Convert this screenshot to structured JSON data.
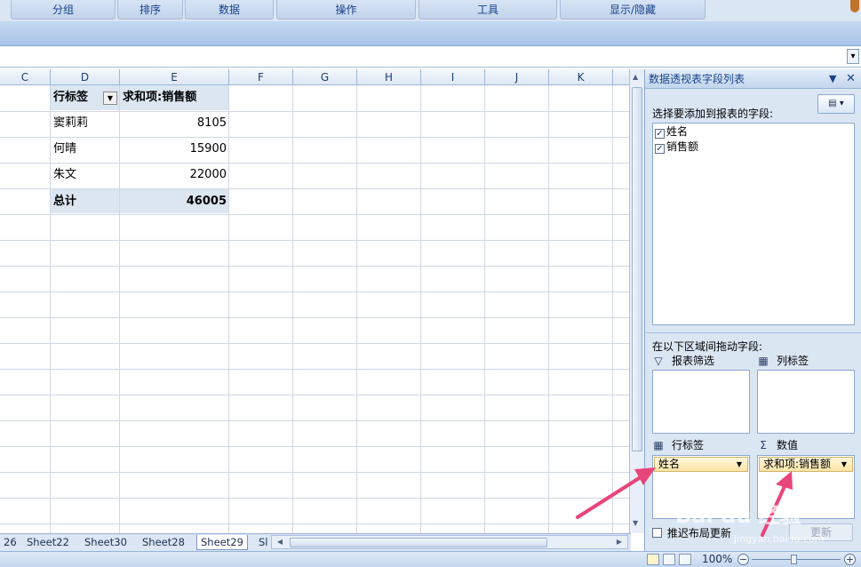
{
  "ribbon": {
    "groups": [
      "分组",
      "排序",
      "数据",
      "操作",
      "工具",
      "显示/隐藏"
    ]
  },
  "grid": {
    "columns": [
      "C",
      "D",
      "E",
      "F",
      "G",
      "H",
      "I",
      "J",
      "K"
    ],
    "pivot": {
      "row_header": "行标签",
      "value_header": "求和项:销售额",
      "rows": [
        {
          "name": "窦莉莉",
          "value": "8105"
        },
        {
          "name": "何晴",
          "value": "15900"
        },
        {
          "name": "朱文",
          "value": "22000"
        }
      ],
      "total_label": "总计",
      "total_value": "46005"
    }
  },
  "sheets": {
    "tabs": [
      "26",
      "Sheet22",
      "Sheet30",
      "Sheet28",
      "Sheet29",
      "Sl"
    ],
    "active": "Sheet29"
  },
  "status": {
    "zoom": "100%"
  },
  "field_list": {
    "title": "数据透视表字段列表",
    "choose_fields_label": "选择要添加到报表的字段:",
    "fields": [
      {
        "name": "姓名",
        "checked": true
      },
      {
        "name": "销售额",
        "checked": true
      }
    ],
    "drag_label": "在以下区域间拖动字段:",
    "report_filter_label": "报表筛选",
    "column_labels_label": "列标签",
    "row_labels_label": "行标签",
    "values_label": "数值",
    "row_field": "姓名",
    "value_field": "求和项:销售额",
    "defer_label": "推迟布局更新",
    "update_label": "更新"
  },
  "watermark": {
    "text": "Bai du 经验",
    "url": "jingyan.baidu.com"
  },
  "colors": {
    "accent": "#15428b",
    "pivot_header": "#dce6f1",
    "arrow": "#e8457a"
  }
}
